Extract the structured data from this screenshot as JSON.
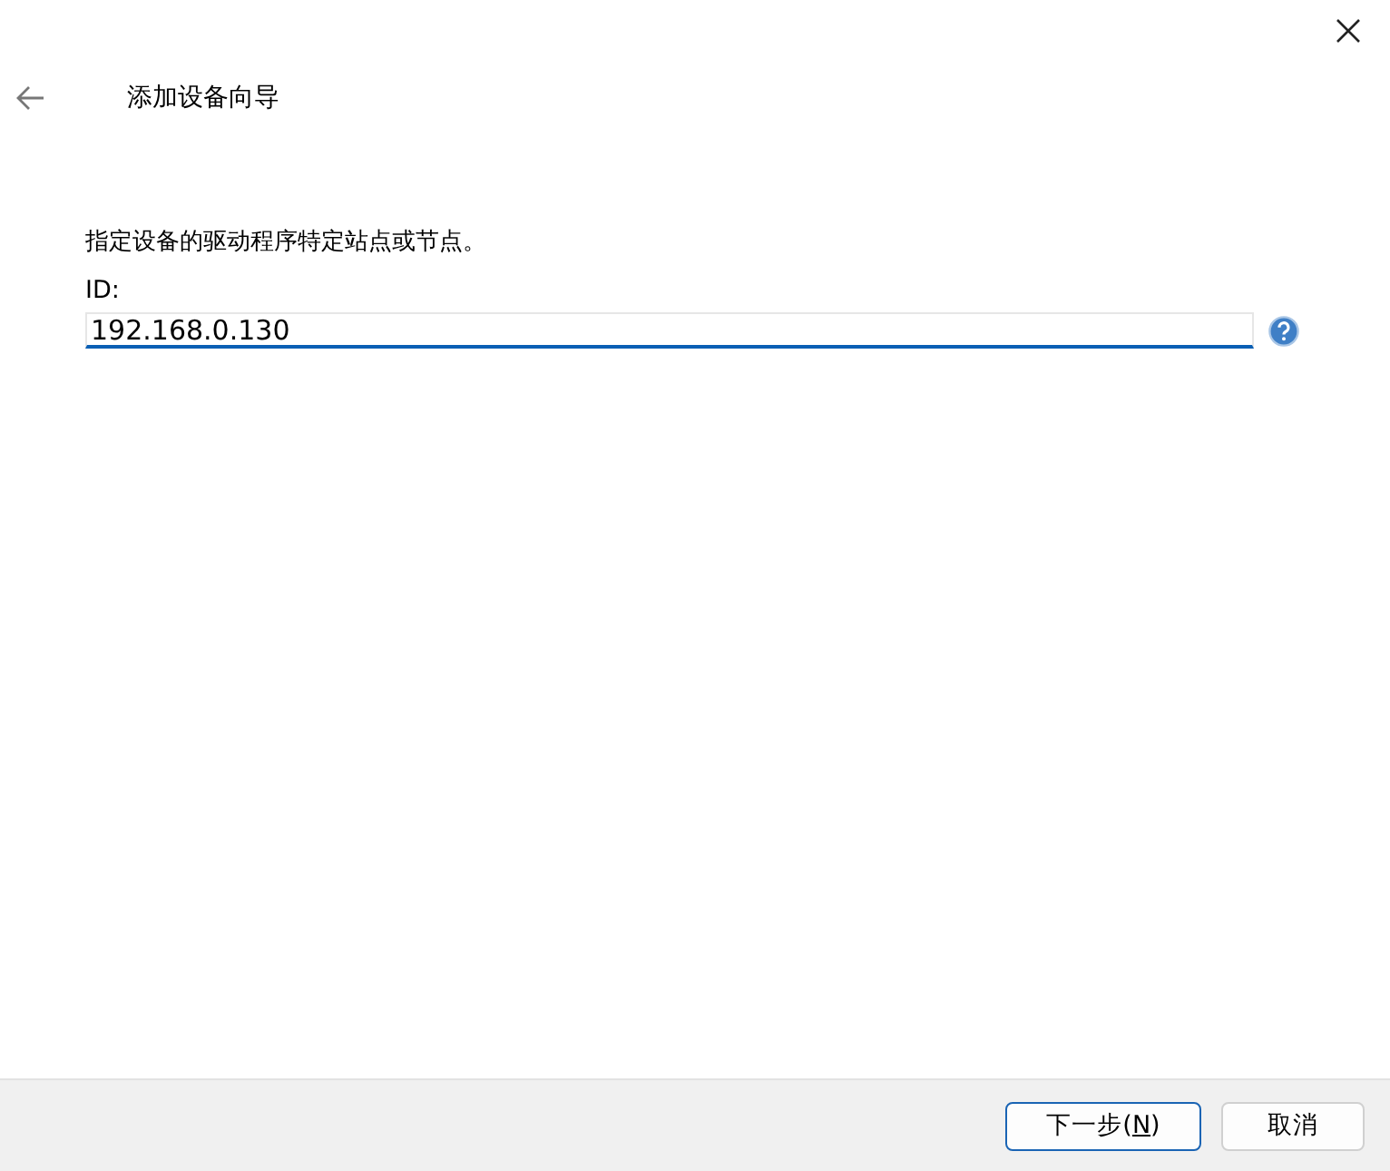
{
  "window": {
    "title": "添加设备向导"
  },
  "instruction": "指定设备的驱动程序特定站点或节点。",
  "field": {
    "label": "ID:",
    "value": "192.168.0.130",
    "focused": true
  },
  "buttons": [
    {
      "label_start": "下一步(",
      "mnemonic": "N",
      "label_end": ")",
      "default": true
    },
    {
      "label_start": "取消",
      "default": false
    }
  ]
}
